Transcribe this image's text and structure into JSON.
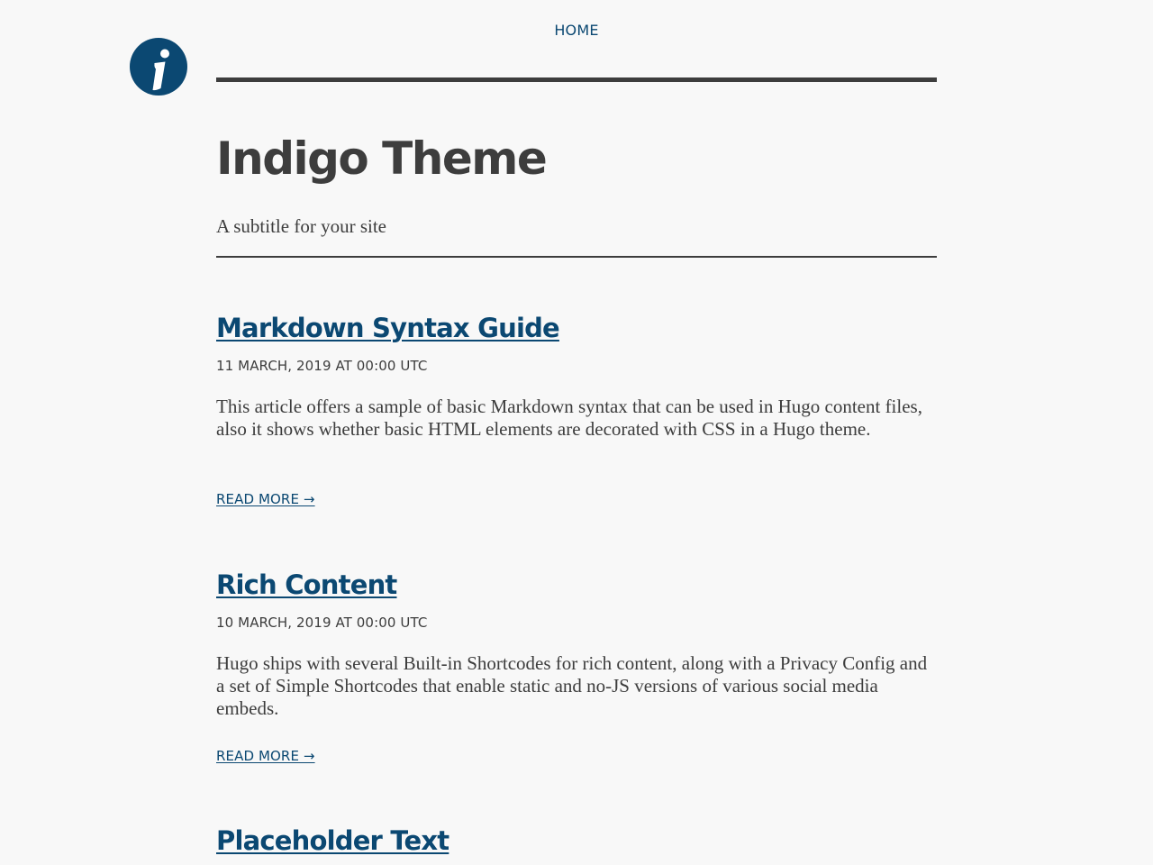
{
  "brand": {
    "logo_icon": "info-icon",
    "logo_color": "#0b4872"
  },
  "nav": {
    "home_label": "HOME"
  },
  "site": {
    "title": "Indigo Theme",
    "subtitle": "A subtitle for your site"
  },
  "posts": [
    {
      "title": "Markdown Syntax Guide",
      "date": "11 MARCH, 2019 AT 00:00 UTC",
      "summary": "This article offers a sample of basic Markdown syntax that can be used in Hugo content files, also it shows whether basic HTML elements are decorated with CSS in a Hugo theme.",
      "read_more": "READ MORE →"
    },
    {
      "title": "Rich Content",
      "date": "10 MARCH, 2019 AT 00:00 UTC",
      "summary": "Hugo ships with several Built-in Shortcodes for rich content, along with a Privacy Config and a set of Simple Shortcodes that enable static and no-JS versions of various social media embeds.",
      "read_more": "READ MORE →"
    },
    {
      "title": "Placeholder Text"
    }
  ],
  "colors": {
    "link": "#0b4872",
    "text": "#3d3d3d",
    "background": "#f8f8f8"
  }
}
